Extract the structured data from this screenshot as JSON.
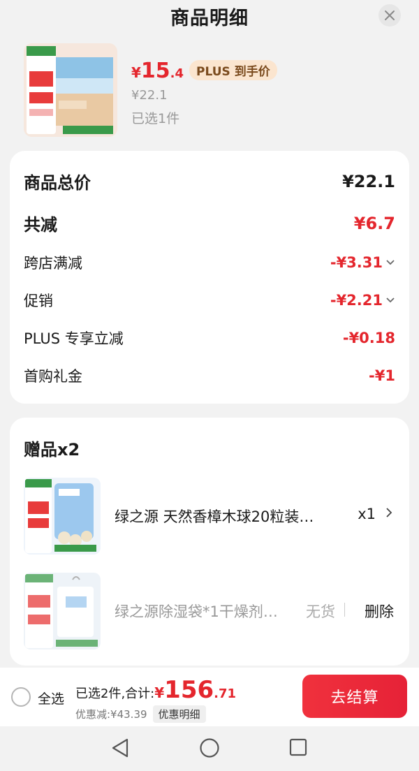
{
  "header": {
    "title": "商品明细"
  },
  "product": {
    "price_yen": "¥",
    "price_int": "15",
    "price_dec": ".4",
    "plus_badge": "PLUS 到手价",
    "original_price": "¥22.1",
    "selected_count": "已选1件"
  },
  "summary": {
    "rows": [
      {
        "label": "商品总价",
        "value": "¥22.1"
      },
      {
        "label": "共减",
        "value": "¥6.7"
      },
      {
        "label": "跨店满减",
        "value": "-¥3.31"
      },
      {
        "label": "促销",
        "value": "-¥2.21"
      },
      {
        "label": "PLUS 专享立减",
        "value": "-¥0.18"
      },
      {
        "label": "首购礼金",
        "value": "-¥1"
      }
    ]
  },
  "gifts": {
    "title": "赠品x2",
    "items": [
      {
        "name": "绿之源 天然香樟木球20粒装…",
        "qty": "x1"
      },
      {
        "name": "绿之源除湿袋*1干燥剂…",
        "status": "无货",
        "action": "删除"
      }
    ]
  },
  "bottom": {
    "select_all": "全选",
    "total_prefix": "已选2件,合计:",
    "total_yen": "¥",
    "total_int": "156",
    "total_dec": ".71",
    "discount": "优惠减:¥43.39",
    "discount_detail": "优惠明细",
    "checkout": "去结算"
  },
  "colors": {
    "accent": "#e4262d",
    "badge_bg": "#fbe5cf",
    "badge_text": "#7a4a1d"
  }
}
